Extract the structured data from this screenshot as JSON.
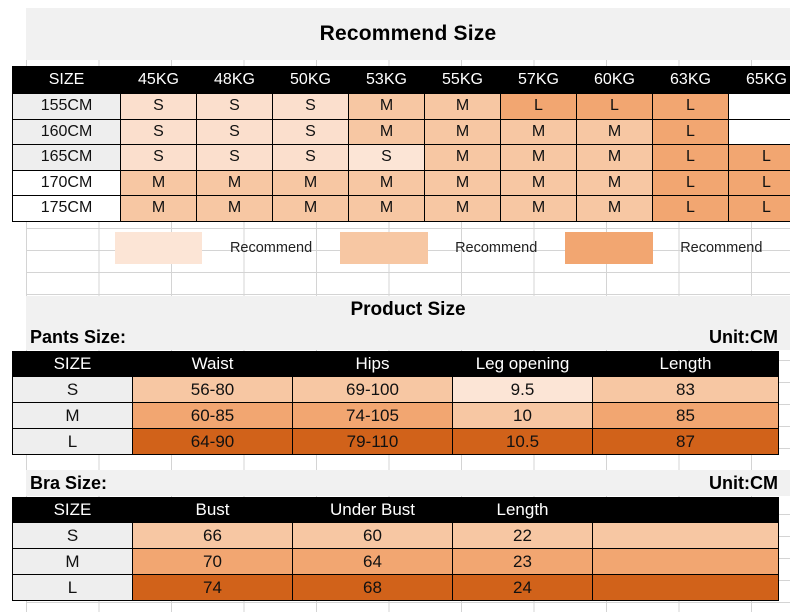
{
  "colors": {
    "tier_s": "#fbdfcd",
    "tier_s_light": "#fce5d6",
    "tier_m": "#f7c7a3",
    "tier_l": "#f2a671",
    "tier_dark": "#d1621a",
    "header_bg": "#000000",
    "header_fg": "#ffffff",
    "title_bg": "#f1f1f1",
    "gridline": "#d4d4d4"
  },
  "recommend": {
    "title": "Recommend Size",
    "corner_label": "SIZE",
    "weights": [
      "45KG",
      "48KG",
      "50KG",
      "53KG",
      "55KG",
      "57KG",
      "60KG",
      "63KG",
      "65KG"
    ],
    "heights": [
      "155CM",
      "160CM",
      "165CM",
      "170CM",
      "175CM"
    ],
    "rows": [
      {
        "height": "155CM",
        "cells": [
          "S",
          "S",
          "S",
          "M",
          "M",
          "L",
          "L",
          "L",
          ""
        ]
      },
      {
        "height": "160CM",
        "cells": [
          "S",
          "S",
          "S",
          "M",
          "M",
          "M",
          "M",
          "L",
          ""
        ]
      },
      {
        "height": "165CM",
        "cells": [
          "S",
          "S",
          "S",
          "S",
          "M",
          "M",
          "M",
          "L",
          "L"
        ]
      },
      {
        "height": "170CM",
        "cells": [
          "M",
          "M",
          "M",
          "M",
          "M",
          "M",
          "M",
          "L",
          "L"
        ]
      },
      {
        "height": "175CM",
        "cells": [
          "M",
          "M",
          "M",
          "M",
          "M",
          "M",
          "M",
          "L",
          "L"
        ]
      }
    ],
    "legend": [
      {
        "label": "Recommend",
        "swatch": "#fce5d6"
      },
      {
        "label": "Recommend",
        "swatch": "#f7c7a3"
      },
      {
        "label": "Recommend",
        "swatch": "#f2a671"
      }
    ]
  },
  "product": {
    "title": "Product Size",
    "pants": {
      "section_label": "Pants Size:",
      "unit_label": "Unit:CM",
      "headers": [
        "SIZE",
        "Waist",
        "Hips",
        "Leg opening",
        "Length"
      ],
      "rows": [
        {
          "size": "S",
          "waist": "56-80",
          "hips": "69-100",
          "leg_opening": "9.5",
          "length": "83"
        },
        {
          "size": "M",
          "waist": "60-85",
          "hips": "74-105",
          "leg_opening": "10",
          "length": "85"
        },
        {
          "size": "L",
          "waist": "64-90",
          "hips": "79-110",
          "leg_opening": "10.5",
          "length": "87"
        }
      ]
    },
    "bra": {
      "section_label": "Bra Size:",
      "unit_label": "Unit:CM",
      "headers": [
        "SIZE",
        "Bust",
        "Under Bust",
        "Length",
        ""
      ],
      "rows": [
        {
          "size": "S",
          "bust": "66",
          "under_bust": "60",
          "length": "22",
          "extra": ""
        },
        {
          "size": "M",
          "bust": "70",
          "under_bust": "64",
          "length": "23",
          "extra": ""
        },
        {
          "size": "L",
          "bust": "74",
          "under_bust": "68",
          "length": "24",
          "extra": ""
        }
      ]
    }
  }
}
